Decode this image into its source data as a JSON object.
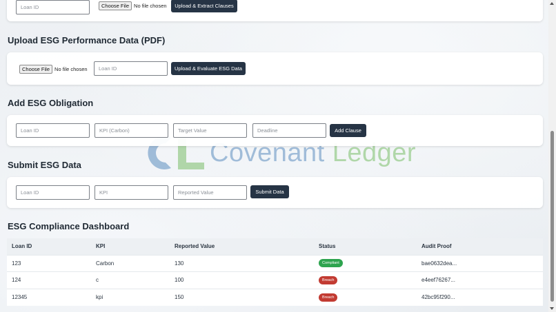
{
  "watermark": {
    "part1": "Covenant ",
    "part2": "Ledger"
  },
  "upload_clauses": {
    "loan_id_placeholder": "Loan ID",
    "file_button": "Choose File",
    "file_status": "No file chosen",
    "submit_label": "Upload & Extract Clauses"
  },
  "upload_esg": {
    "title": "Upload ESG Performance Data (PDF)",
    "file_button": "Choose File",
    "file_status": "No file chosen",
    "loan_id_placeholder": "Loan ID",
    "submit_label": "Upload & Evaluate ESG Data"
  },
  "add_obligation": {
    "title": "Add ESG Obligation",
    "loan_id_placeholder": "Loan ID",
    "kpi_placeholder": "KPI (Carbon)",
    "target_placeholder": "Target Value",
    "deadline_placeholder": "Deadline",
    "submit_label": "Add Clause"
  },
  "submit_esg": {
    "title": "Submit ESG Data",
    "loan_id_placeholder": "Loan ID",
    "kpi_placeholder": "KPI",
    "reported_placeholder": "Reported Value",
    "submit_label": "Submit Data"
  },
  "dashboard": {
    "title": "ESG Compliance Dashboard",
    "columns": [
      "Loan ID",
      "KPI",
      "Reported Value",
      "Status",
      "Audit Proof"
    ],
    "rows": [
      {
        "loan_id": "123",
        "kpi": "Carbon",
        "reported": "130",
        "status": "Compliant",
        "proof": "bae0632dea..."
      },
      {
        "loan_id": "124",
        "kpi": "c",
        "reported": "100",
        "status": "Breach",
        "proof": "e4eef76267..."
      },
      {
        "loan_id": "12345",
        "kpi": "kpi",
        "reported": "150",
        "status": "Breach",
        "proof": "42bc95f290..."
      }
    ]
  },
  "colors": {
    "primary_button": "#263445",
    "compliant": "#2ea44f",
    "breach": "#c23b32"
  }
}
